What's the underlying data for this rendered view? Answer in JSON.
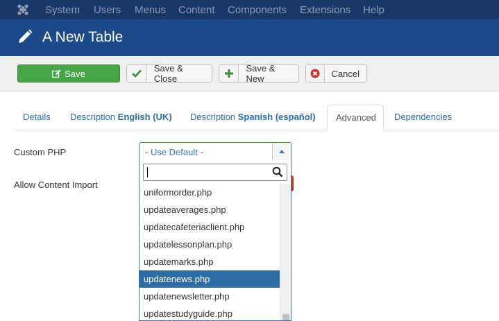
{
  "topnav": {
    "items": [
      "System",
      "Users",
      "Menus",
      "Content",
      "Components",
      "Extensions",
      "Help"
    ]
  },
  "header": {
    "title": "A New Table"
  },
  "toolbar": {
    "save": "Save",
    "save_close": "Save & Close",
    "save_new": "Save & New",
    "cancel": "Cancel"
  },
  "tabs": [
    {
      "label": "Details"
    },
    {
      "label": "Description",
      "strong": "English (UK)"
    },
    {
      "label": "Description",
      "strong": "Spanish (español)"
    },
    {
      "label": "Advanced",
      "active": true
    },
    {
      "label": "Dependencies"
    }
  ],
  "form": {
    "custom_php_label": "Custom PHP",
    "allow_import_label": "Allow Content Import",
    "custom_php_value": "- Use Default -",
    "search_value": ""
  },
  "dropdown": {
    "options": [
      "uniformorder.php",
      "updateaverages.php",
      "updatecafeteriaclient.php",
      "updatelessonplan.php",
      "updatemarks.php",
      "updatenews.php",
      "updatenewsletter.php",
      "updatestudyguide.php"
    ],
    "highlighted": "updatenews.php"
  },
  "colors": {
    "navbar": "#1a3867",
    "titlebar": "#1c4a8a",
    "save_button": "#46a546",
    "link": "#2c6db0",
    "highlight": "#2e6da4"
  }
}
